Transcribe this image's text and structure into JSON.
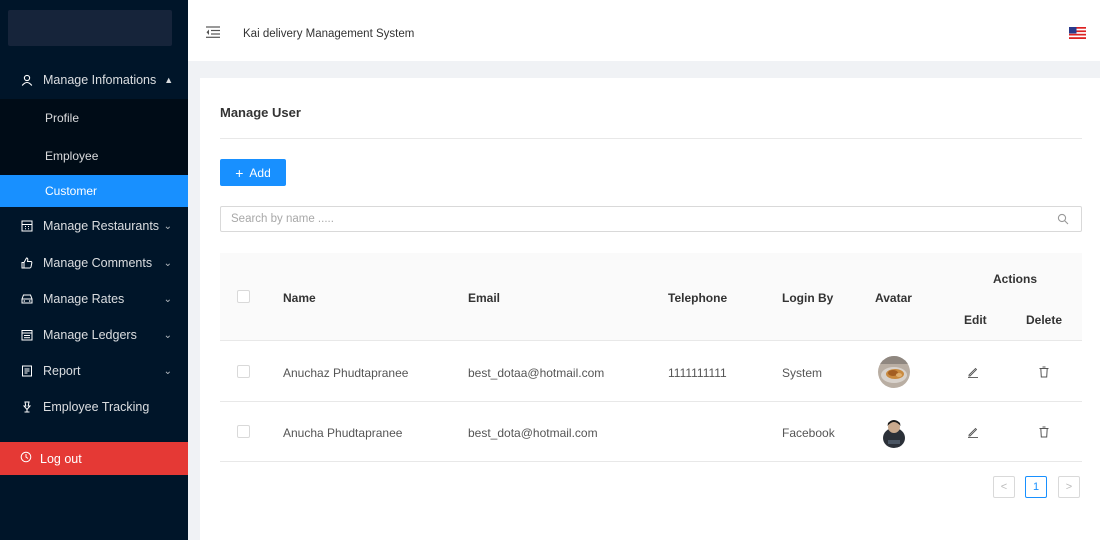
{
  "header": {
    "title": "Kai delivery Management System",
    "trigger_icon": "menu-fold-icon",
    "language_icon": "us-flag-icon"
  },
  "sidebar": {
    "group": {
      "label": "Manage Infomations",
      "icon": "user-icon",
      "expanded": true
    },
    "subitems": [
      {
        "label": "Profile",
        "active": false
      },
      {
        "label": "Employee",
        "active": false
      },
      {
        "label": "Customer",
        "active": true
      }
    ],
    "items": [
      {
        "label": "Manage Restaurants",
        "icon": "calculator-icon",
        "has_children": true
      },
      {
        "label": "Manage Comments",
        "icon": "like-icon",
        "has_children": true
      },
      {
        "label": "Manage Rates",
        "icon": "car-icon",
        "has_children": true
      },
      {
        "label": "Manage Ledgers",
        "icon": "calendar-icon",
        "has_children": true
      },
      {
        "label": "Report",
        "icon": "file-icon",
        "has_children": true
      },
      {
        "label": "Employee Tracking",
        "icon": "map-pin-icon",
        "has_children": false
      }
    ],
    "logout": {
      "label": "Log out",
      "icon": "power-icon"
    }
  },
  "main": {
    "title": "Manage User",
    "add_label": "Add",
    "search_placeholder": "Search by name .....",
    "search_value": ""
  },
  "table": {
    "headers": {
      "name": "Name",
      "email": "Email",
      "telephone": "Telephone",
      "login_by": "Login By",
      "avatar": "Avatar",
      "actions": "Actions",
      "edit": "Edit",
      "delete": "Delete"
    },
    "rows": [
      {
        "name": "Anuchaz Phudtapranee",
        "email": "best_dotaa@hotmail.com",
        "telephone": "1111111111",
        "login_by": "System"
      },
      {
        "name": "Anucha Phudtapranee",
        "email": "best_dota@hotmail.com",
        "telephone": "",
        "login_by": "Facebook"
      }
    ]
  },
  "pagination": {
    "current": "1",
    "prev": "<",
    "next": ">"
  },
  "colors": {
    "primary": "#1890ff",
    "sidebar": "#001529",
    "logout": "#e53935"
  }
}
